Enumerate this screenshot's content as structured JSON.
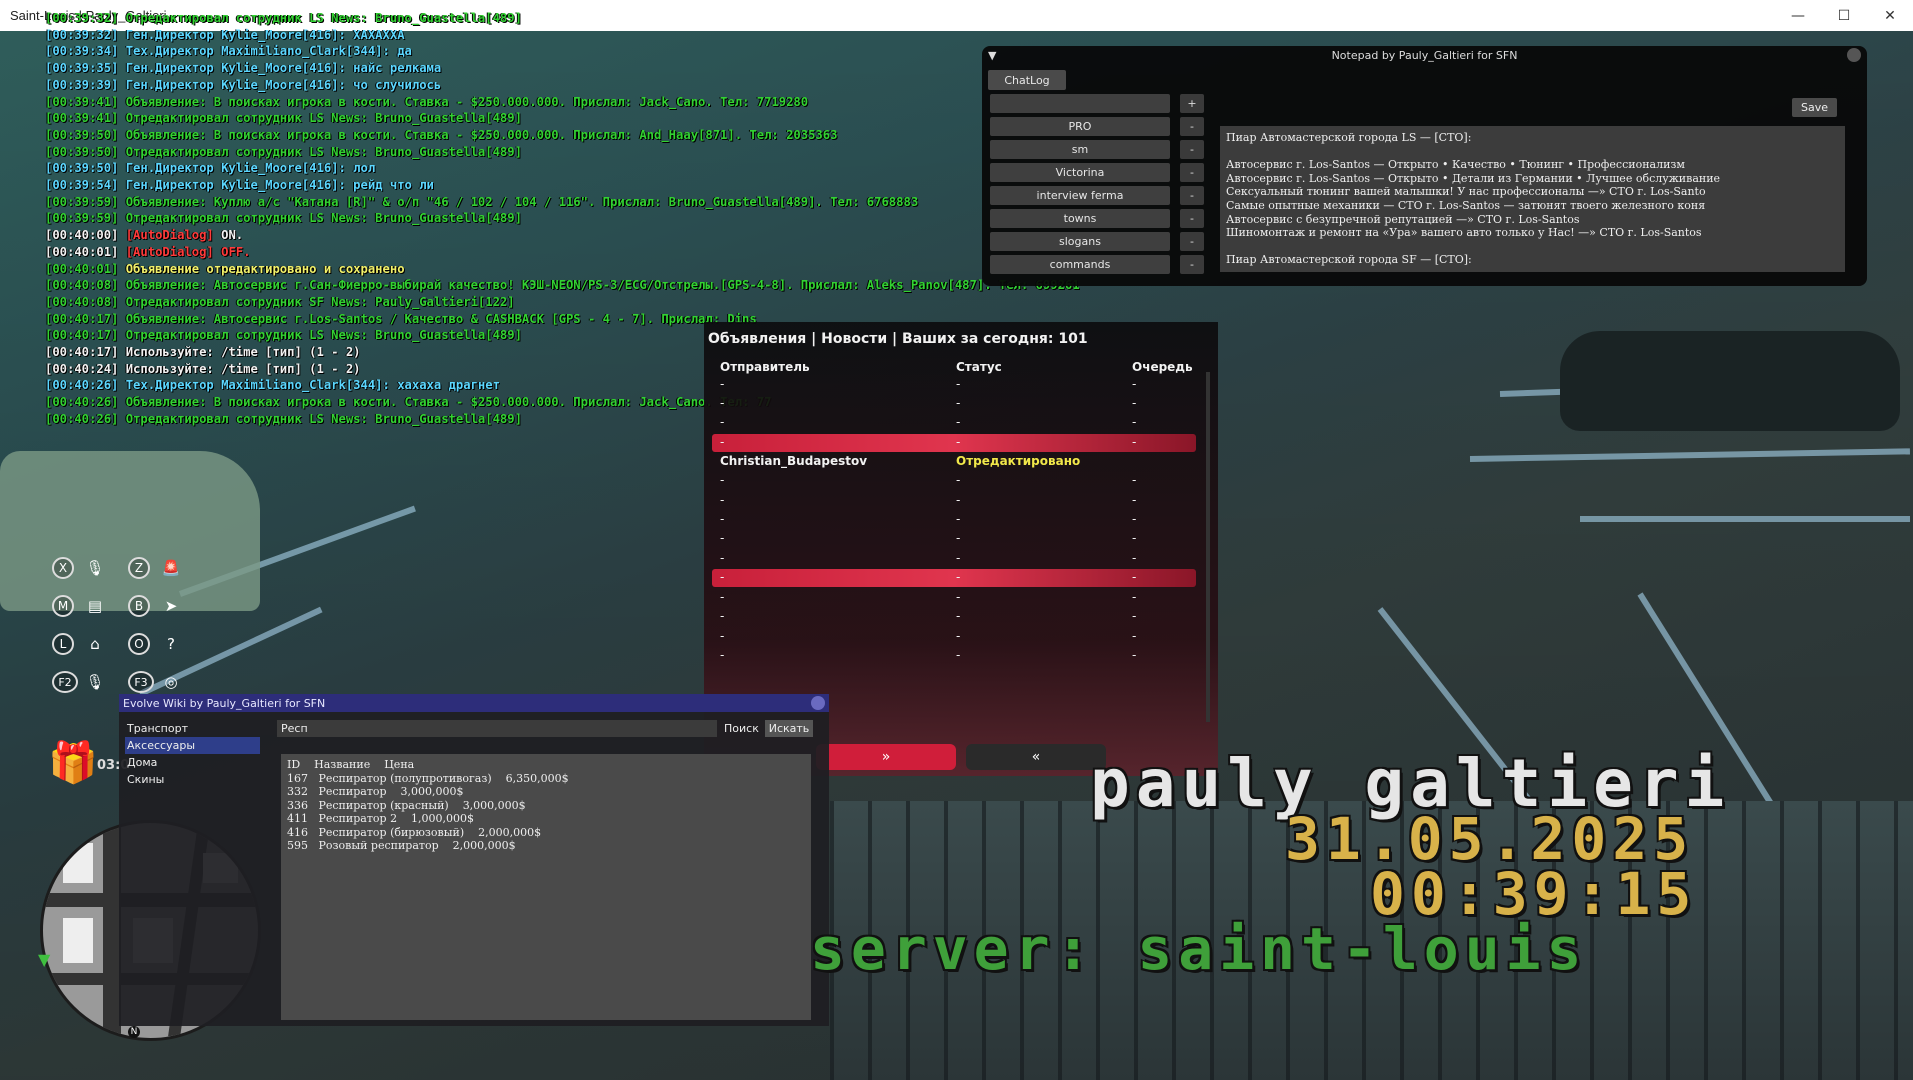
{
  "window": {
    "title": "Saint-Louis | Pauly_Galtieri",
    "minimize": "—",
    "maximize": "☐",
    "close": "✕"
  },
  "chat": [
    {
      "ts": "[00:39:32]",
      "text": "    Отредактировал сотрудник LS News: Bruno_Guastella[489]",
      "tc": "green",
      "pc": "green"
    },
    {
      "ts": "[00:39:32]",
      "text": " Ген.Директор Kylie_Moore[416]: ХАХАХХА",
      "tc": "cyan",
      "pc": "cyan"
    },
    {
      "ts": "[00:39:34]",
      "text": " Тех.Директор Maximiliano_Clark[344]: да",
      "tc": "cyan",
      "pc": "cyan"
    },
    {
      "ts": "[00:39:35]",
      "text": " Ген.Директор Kylie_Moore[416]: найс релкама",
      "tc": "cyan",
      "pc": "cyan"
    },
    {
      "ts": "[00:39:39]",
      "text": " Ген.Директор Kylie_Moore[416]: чо случилось",
      "tc": "cyan",
      "pc": "cyan"
    },
    {
      "ts": "[00:39:41]",
      "text": " Объявление: В поисках игрока в кости. Ставка - $250.000.000. Прислал: Jack_Cano. Тел: 7719280",
      "tc": "green",
      "pc": "green"
    },
    {
      "ts": "[00:39:41]",
      "text": "    Отредактировал сотрудник LS News: Bruno_Guastella[489]",
      "tc": "green",
      "pc": "green"
    },
    {
      "ts": "[00:39:50]",
      "text": " Объявление: В поисках игрока в кости. Ставка - $250.000.000. Прислал: And_Haay[871]. Тел: 2035363",
      "tc": "green",
      "pc": "green"
    },
    {
      "ts": "[00:39:50]",
      "text": "    Отредактировал сотрудник LS News: Bruno_Guastella[489]",
      "tc": "green",
      "pc": "green"
    },
    {
      "ts": "[00:39:50]",
      "text": " Ген.Директор Kylie_Moore[416]: лол",
      "tc": "cyan",
      "pc": "cyan"
    },
    {
      "ts": "[00:39:54]",
      "text": " Ген.Директор Kylie_Moore[416]: рейд что ли",
      "tc": "cyan",
      "pc": "cyan"
    },
    {
      "ts": "[00:39:59]",
      "text": " Объявление: Куплю а/с \"Катана [R]\" & о/п \"46 / 102 / 104 / 116\". Прислал: Bruno_Guastella[489]. Тел: 6768883",
      "tc": "green",
      "pc": "green"
    },
    {
      "ts": "[00:39:59]",
      "text": "    Отредактировал сотрудник LS News: Bruno_Guastella[489]",
      "tc": "green",
      "pc": "green"
    },
    {
      "ts": "[00:40:00]",
      "text": " ",
      "tag": "[AutoDialog]",
      "rest": " ON.",
      "tc": "white",
      "pc": "white"
    },
    {
      "ts": "[00:40:01]",
      "text": " ",
      "tag": "[AutoDialog]",
      "rest": " OFF.",
      "tc": "white",
      "pc": "white"
    },
    {
      "ts": "[00:40:01]",
      "text": " Объявление отредактировано и сохранено",
      "tc": "yellow",
      "pc": "green"
    },
    {
      "ts": "[00:40:08]",
      "text": " Объявление: Автосервис г.Сан-Фиерро-выбирай качество! КЭШ-NEON/PS-3/ECG/Отстрелы.[GPS-4-8]. Прислал: Aleks_Panov[487]. Тел: 699261",
      "tc": "green",
      "pc": "green"
    },
    {
      "ts": "[00:40:08]",
      "text": "    Отредактировал сотрудник SF News: Pauly_Galtieri[122]",
      "tc": "green",
      "pc": "green"
    },
    {
      "ts": "[00:40:17]",
      "text": " Объявление: Автосервис г.Los-Santos / Качество & CASHBACK [GPS - 4 - 7]. Прислал: Dins",
      "tc": "green",
      "pc": "green"
    },
    {
      "ts": "[00:40:17]",
      "text": "    Отредактировал сотрудник LS News: Bruno_Guastella[489]",
      "tc": "green",
      "pc": "green"
    },
    {
      "ts": "[00:40:17]",
      "text": " Используйте: /time [тип] (1 - 2)",
      "tc": "white",
      "pc": "white"
    },
    {
      "ts": "[00:40:24]",
      "text": " Используйте: /time [тип] (1 - 2)",
      "tc": "white",
      "pc": "white"
    },
    {
      "ts": "[00:40:26]",
      "text": " Тех.Директор Maximiliano_Clark[344]: хахаха драгнет",
      "tc": "cyan",
      "pc": "cyan"
    },
    {
      "ts": "[00:40:26]",
      "text": " Объявление: В поисках игрока в кости. Ставка - $250.000.000. Прислал: Jack_Cano. Тел: 77",
      "tc": "green",
      "pc": "green"
    },
    {
      "ts": "[00:40:26]",
      "text": "    Отредактировал сотрудник LS News: Bruno_Guastella[489]",
      "tc": "green",
      "pc": "green"
    }
  ],
  "notepad": {
    "title": "Notepad by Pauly_Galtieri for SFN",
    "collapse_arrow": "▼",
    "tab": "ChatLog",
    "save": "Save",
    "items": [
      {
        "label": "",
        "btn": "+"
      },
      {
        "label": "PRO",
        "btn": "-"
      },
      {
        "label": "sm",
        "btn": "-"
      },
      {
        "label": "Victorina",
        "btn": "-"
      },
      {
        "label": "interview ferma",
        "btn": "-"
      },
      {
        "label": "towns",
        "btn": "-"
      },
      {
        "label": "slogans",
        "btn": "-"
      },
      {
        "label": "commands",
        "btn": "-"
      }
    ],
    "lines": [
      "Пиар Автомастерской города LS — [СТО]:",
      "",
      "Автосервис г. Los-Santos — Открыто • Качество • Тюнинг • Профессионализм",
      "Автосервис г. Los-Santos — Открыто • Детали из Германии • Лучшее обслуживание",
      "Сексуальный тюнинг вашей малышки! У нас профессионалы —» СТО г. Los-Santo",
      "Самые опытные механики — СТО г. Los-Santos — затюнят твоего железного коня",
      "Автосервис с безупречной репутацией —» СТО г. Los-Santos",
      "Шиномонтаж и ремонт на «Ура» вашего авто только у Нас! —» СТО г. Los-Santos",
      "",
      "Пиар Автомастерской города SF — [СТО]:"
    ]
  },
  "ads": {
    "title": "Объявления | Новости | Ваших за сегодня: 101",
    "headers": {
      "sender": "Отправитель",
      "status": "Статус",
      "queue": "Очередь"
    },
    "rows": [
      {
        "s": "-",
        "st": "-",
        "q": "-"
      },
      {
        "s": "-",
        "st": "-",
        "q": "-"
      },
      {
        "s": "-",
        "st": "-",
        "q": "-"
      },
      {
        "s": "-",
        "st": "-",
        "q": "-",
        "sel": true
      },
      {
        "s": "Christian_Budapestov",
        "st": "Отредактировано",
        "q": "",
        "bold": true
      },
      {
        "s": "-",
        "st": "-",
        "q": "-"
      },
      {
        "s": "-",
        "st": "-",
        "q": "-"
      },
      {
        "s": "-",
        "st": "-",
        "q": "-"
      },
      {
        "s": "-",
        "st": "-",
        "q": "-"
      },
      {
        "s": "-",
        "st": "-",
        "q": "-"
      },
      {
        "s": "-",
        "st": "-",
        "q": "-",
        "sel": true
      },
      {
        "s": "-",
        "st": "-",
        "q": "-"
      },
      {
        "s": "-",
        "st": "-",
        "q": "-"
      },
      {
        "s": "-",
        "st": "-",
        "q": "-"
      },
      {
        "s": "-",
        "st": "-",
        "q": "-"
      }
    ],
    "next": "»",
    "prev": "«"
  },
  "hud_keys": [
    {
      "k": "X",
      "icon": "🎙",
      "iname": "microphone-icon"
    },
    {
      "k": "Z",
      "icon": "🚨",
      "iname": "siren-icon"
    },
    {
      "k": "M",
      "icon": "▤",
      "iname": "list-icon"
    },
    {
      "k": "B",
      "icon": "➤",
      "iname": "cursor-icon"
    },
    {
      "k": "L",
      "icon": "⌂",
      "iname": "car-door-icon"
    },
    {
      "k": "O",
      "icon": "?",
      "iname": "help-icon"
    },
    {
      "k": "F2",
      "icon": "🎙",
      "iname": "voice-icon"
    },
    {
      "k": "F3",
      "icon": "◎",
      "iname": "eye-off-icon"
    }
  ],
  "gift_timer": "03:0",
  "wiki": {
    "title": "Evolve Wiki by Pauly_Galtieri for SFN",
    "categories": [
      "Транспорт",
      "Аксессуары",
      "Дома",
      "Скины"
    ],
    "selected_category": 1,
    "search_value": "Респ",
    "search_label": "Поиск",
    "search_button": "Искать",
    "results_header": "ID    Название    Цена",
    "results": [
      "167   Респиратор (полупротивогаз)    6,350,000$",
      "332   Респиратор    3,000,000$",
      "336   Респиратор (красный)    3,000,000$",
      "411   Респиратор 2    1,000,000$",
      "416   Респиратор (бирюзовый)    2,000,000$",
      "595   Розовый респиратор    2,000,000$"
    ]
  },
  "watermark": {
    "name": "pauly galtieri",
    "date": "31.05.2025",
    "time": "00:39:15",
    "server": "server: saint-louis"
  }
}
